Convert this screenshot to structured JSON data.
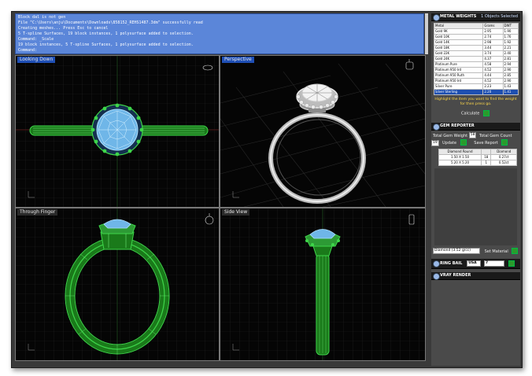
{
  "command": {
    "lines": [
      "Block dal is not gen",
      "File \"C:\\Users\\anju\\Documents\\Downloads\\858152_REHS1487.3dm\" successfully read",
      "Creating meshes... Press Esc to cancel",
      "5 T-spline Surfaces, 19 block instances, 1 polysurface added to selection.",
      "Command: _Scale",
      "19 block instances, 5 T-spline Surfaces, 1 polysurface added to selection."
    ],
    "prompt": "Command:"
  },
  "viewports": {
    "top_left": "Looking Down",
    "top_right": "Perspective",
    "bottom_left": "Through Finger",
    "bottom_right": "Side View"
  },
  "metal_weights": {
    "title": "METAL WEIGHTS",
    "subtitle": "1 Objects Selected",
    "columns": [
      "Metal",
      "Grams",
      "DWT"
    ],
    "rows": [
      [
        "Gold 9K",
        "2.95",
        "1.90"
      ],
      [
        "Gold 10K",
        "2.74",
        "1.76"
      ],
      [
        "Gold 14K",
        "2.98",
        "1.92"
      ],
      [
        "Gold 18K",
        "3.44",
        "2.21"
      ],
      [
        "Gold 22K",
        "3.74",
        "2.40"
      ],
      [
        "Gold 24K",
        "4.37",
        "2.81"
      ],
      [
        "Platinum Pure",
        "4.58",
        "2.94"
      ],
      [
        "Platinum 950 Ird",
        "4.52",
        "2.90"
      ],
      [
        "Platinum 950 Ruth",
        "4.44",
        "2.85"
      ],
      [
        "Platinum 950 Ird",
        "4.52",
        "2.90"
      ],
      [
        "Silver Pure",
        "2.23",
        "1.43"
      ],
      [
        "Silver Sterling",
        "2.20",
        "1.41"
      ]
    ],
    "hint": "Highlight the item you want to find the weight for then press go.",
    "calculate_label": "Calculate"
  },
  "gem_reporter": {
    "title": "GEM REPORTER",
    "total_weight_label": "Total Gem Weight",
    "total_weight_value": "58",
    "total_count_label": "Total Gem Count",
    "total_count_value": "19",
    "update_label": "Update",
    "save_label": "Save Report",
    "columns": [
      "Diamond Round",
      "",
      "Diamond"
    ],
    "rows": [
      [
        "1.50 X 1.50",
        "18",
        "0.27ct"
      ],
      [
        "5.20 X 5.20",
        "1",
        "0.52ct"
      ]
    ],
    "material_select": "Diamond (3.52 g/cc)",
    "set_material_label": "Set Material"
  },
  "ring_bail": {
    "title": "RING BAIL",
    "region": "USA",
    "size": "7"
  },
  "vray": {
    "title": "VRAY RENDER"
  },
  "colors": {
    "command_bg": "#5b86d9",
    "viewport_bg": "#050505",
    "wire_green": "#3ed64a",
    "gem_blue": "#7fc8ff",
    "panel_bg": "#4a4a4a"
  }
}
